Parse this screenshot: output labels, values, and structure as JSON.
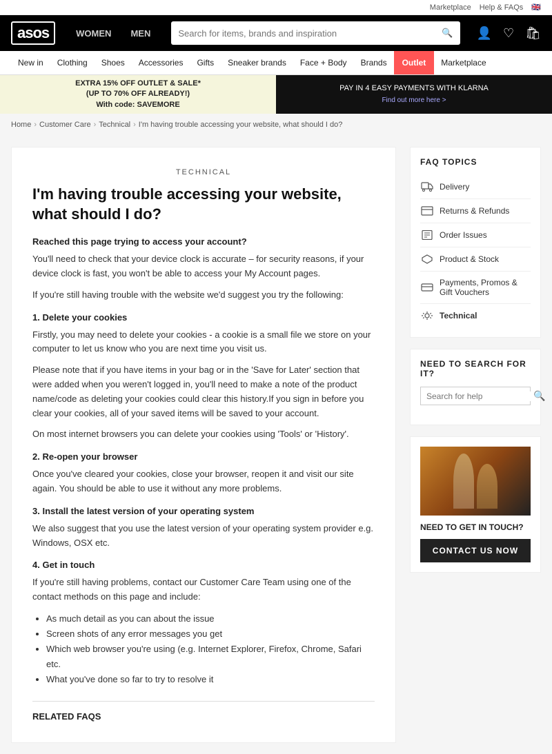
{
  "topbar": {
    "marketplace": "Marketplace",
    "help": "Help & FAQs",
    "flag": "🇬🇧"
  },
  "header": {
    "logo": "asos",
    "nav": [
      {
        "id": "women",
        "label": "WOMEN"
      },
      {
        "id": "men",
        "label": "MEN"
      }
    ],
    "search_placeholder": "Search for items, brands and inspiration"
  },
  "mainnav": {
    "items": [
      {
        "id": "new-in",
        "label": "New in"
      },
      {
        "id": "clothing",
        "label": "Clothing"
      },
      {
        "id": "shoes",
        "label": "Shoes"
      },
      {
        "id": "accessories",
        "label": "Accessories"
      },
      {
        "id": "gifts",
        "label": "Gifts"
      },
      {
        "id": "sneaker-brands",
        "label": "Sneaker brands"
      },
      {
        "id": "face-body",
        "label": "Face + Body"
      },
      {
        "id": "brands",
        "label": "Brands"
      },
      {
        "id": "outlet",
        "label": "Outlet",
        "highlight": true
      },
      {
        "id": "marketplace",
        "label": "Marketplace"
      }
    ]
  },
  "promo": {
    "left_line1": "EXTRA 15% OFF OUTLET & SALE*",
    "left_line2": "(UP TO 70% OFF ALREADY!)",
    "left_line3": "With code: SAVEMORE",
    "right_line1": "PAY IN 4 EASY PAYMENTS WITH KLARNA",
    "right_line2": "Find out more here >"
  },
  "breadcrumb": {
    "items": [
      "Home",
      "Customer Care",
      "Technical",
      "I'm having trouble accessing your website, what should I do?"
    ]
  },
  "article": {
    "tag": "TECHNICAL",
    "title": "I'm having trouble accessing your website, what should I do?",
    "section1_heading": "Reached this page trying to access your account?",
    "section1_p1": "You'll need to check that your device clock is accurate – for security reasons, if your device clock is fast, you won't be able to access your My Account pages.",
    "section1_p2": "If you're still having trouble with the website we'd suggest you try the following:",
    "step1_heading": "1. Delete your cookies",
    "step1_p1": "Firstly, you may need to delete your cookies - a cookie is a small file we store on your computer to let us know who you are next time you visit us.",
    "step1_p2": "Please note that if you have items in your bag or in the 'Save for Later' section that were added when you weren't logged in, you'll need to make a note of the product name/code as deleting your cookies could clear this history.If you sign in before you clear your cookies, all of your saved items will be saved to your account.",
    "step1_p3": "On most internet browsers you can delete your cookies using 'Tools' or 'History'.",
    "step2_heading": "2. Re-open your browser",
    "step2_p1": "Once you've cleared your cookies, close your browser, reopen it and visit our site again. You should be able to use it without any more problems.",
    "step3_heading": "3. Install the latest version of your operating system",
    "step3_p1": "We also suggest that you use the latest version of your operating system provider e.g. Windows, OSX etc.",
    "step4_heading": "4. Get in touch",
    "step4_p1": "If you're still having problems, contact our Customer Care Team using one of the contact methods on this page and include:",
    "bullets": [
      "As much detail as you can about the issue",
      "Screen shots of any error messages you get",
      "Which web browser you're using (e.g. Internet Explorer, Firefox, Chrome, Safari etc.",
      "What you've done so far to try to resolve it"
    ],
    "related_faqs_title": "RELATED FAQS"
  },
  "sidebar": {
    "faq_title": "FAQ TOPICS",
    "faq_items": [
      {
        "id": "delivery",
        "label": "Delivery"
      },
      {
        "id": "returns",
        "label": "Returns & Refunds"
      },
      {
        "id": "order-issues",
        "label": "Order Issues"
      },
      {
        "id": "product-stock",
        "label": "Product & Stock"
      },
      {
        "id": "payments",
        "label": "Payments, Promos & Gift Vouchers"
      },
      {
        "id": "technical",
        "label": "Technical",
        "active": true
      }
    ],
    "search_title": "NEED TO SEARCH FOR IT?",
    "search_placeholder": "Search for help",
    "contact_title": "NEED TO GET IN TOUCH?",
    "contact_btn": "CONTACT US NOW"
  }
}
